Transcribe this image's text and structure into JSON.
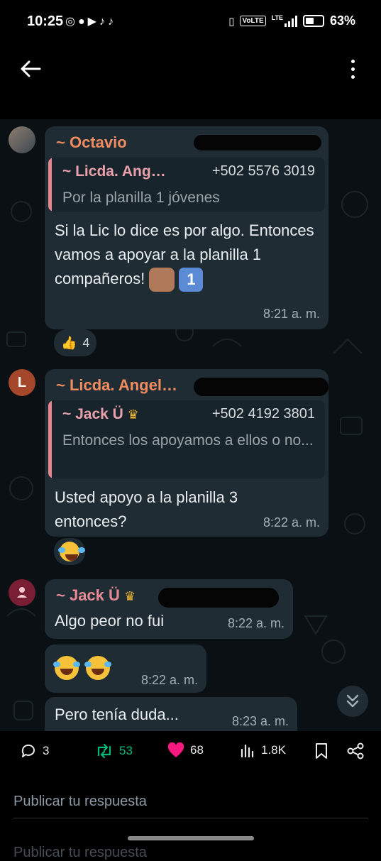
{
  "status_bar": {
    "time": "10:25",
    "network": "LTE",
    "volte": "VoLTE",
    "battery": "63%",
    "battery_level": 0.63
  },
  "chat": {
    "messages": [
      {
        "sender": "~ Octavio",
        "quote": {
          "name": "~ Licda. Ang…",
          "phone": "+502 5576 3019",
          "text": "Por la planilla 1 jóvenes"
        },
        "text": "Si la Lic lo dice es por algo. Entonces vamos a apoyar a la planilla 1 compañeros!",
        "time": "8:21 a. m.",
        "reaction_count": "4"
      },
      {
        "avatar_letter": "L",
        "sender": "~ Licda. Angel…",
        "quote": {
          "name": "~ Jack Ü",
          "phone": "+502 4192 3801",
          "text": "Entonces los apoyamos a ellos o no..."
        },
        "text": "Usted apoyo a la planilla 3 entonces?",
        "time": "8:22 a. m."
      },
      {
        "sender": "~ Jack Ü",
        "text": "Algo peor no fui",
        "time": "8:22 a. m."
      },
      {
        "text": "",
        "time": "8:22 a. m."
      },
      {
        "text": "Pero tenía duda...",
        "time": "8:23 a. m."
      }
    ]
  },
  "tweet_actions": {
    "replies": "3",
    "retweets": "53",
    "likes": "68",
    "views": "1.8K"
  },
  "reply": {
    "placeholder": "Publicar tu respuesta"
  },
  "colors": {
    "chat_bg": "#0b1014",
    "bubble": "#1f2c33",
    "sender_orange": "#f08c5f",
    "sender_pink": "#e98a96",
    "retweet_green": "#00ba7c",
    "like_pink": "#f91880"
  }
}
